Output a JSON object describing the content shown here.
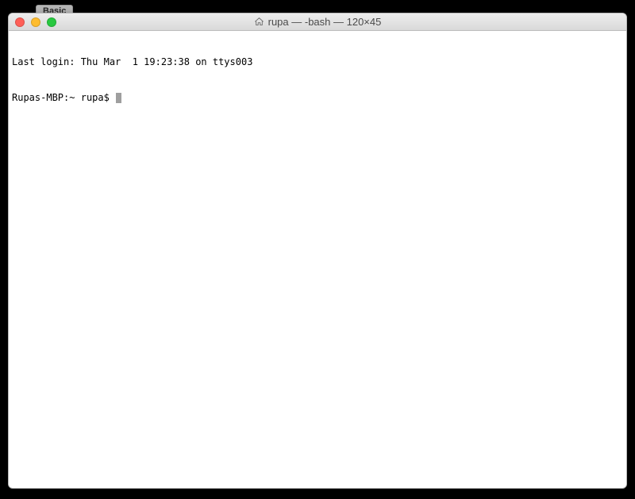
{
  "backdrop": {
    "tab_label": "Basic"
  },
  "window": {
    "title": "rupa — -bash — 120×45",
    "icon": "home-icon"
  },
  "terminal": {
    "motd": "Last login: Thu Mar  1 19:23:38 on ttys003",
    "prompt_host": "Rupas-MBP:",
    "prompt_path": "~",
    "prompt_user": "rupa$",
    "input": ""
  }
}
